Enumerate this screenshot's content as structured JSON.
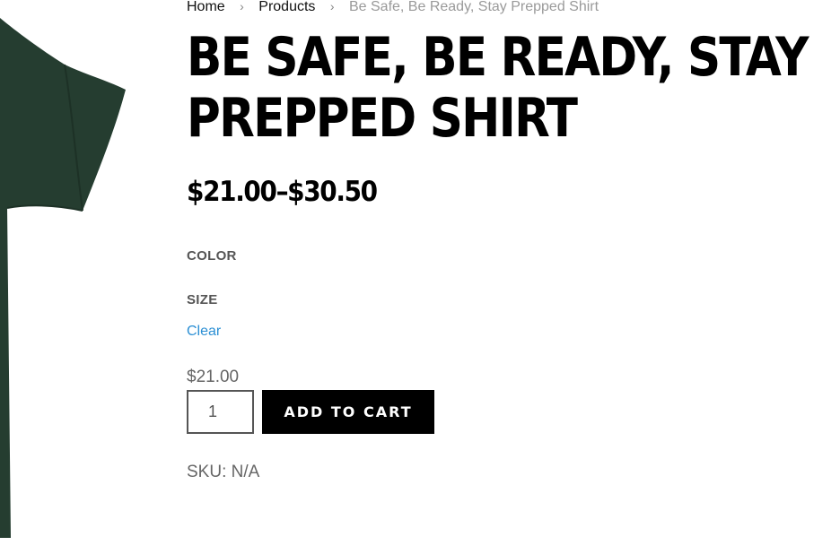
{
  "breadcrumb": {
    "home": "Home",
    "separator": "›",
    "products": "Products",
    "current": "Be Safe, Be Ready, Stay Prepped Shirt"
  },
  "product": {
    "title": "BE SAFE, BE READY, STAY PREPPED SHIRT",
    "price_range": "$21.00–$30.50",
    "shirt_color": "#253d30",
    "attributes": {
      "color_label": "COLOR",
      "size_label": "SIZE",
      "clear_label": "Clear"
    },
    "variation_price": "$21.00",
    "quantity": "1",
    "add_to_cart_label": "ADD TO CART",
    "sku_text": "SKU: N/A"
  }
}
